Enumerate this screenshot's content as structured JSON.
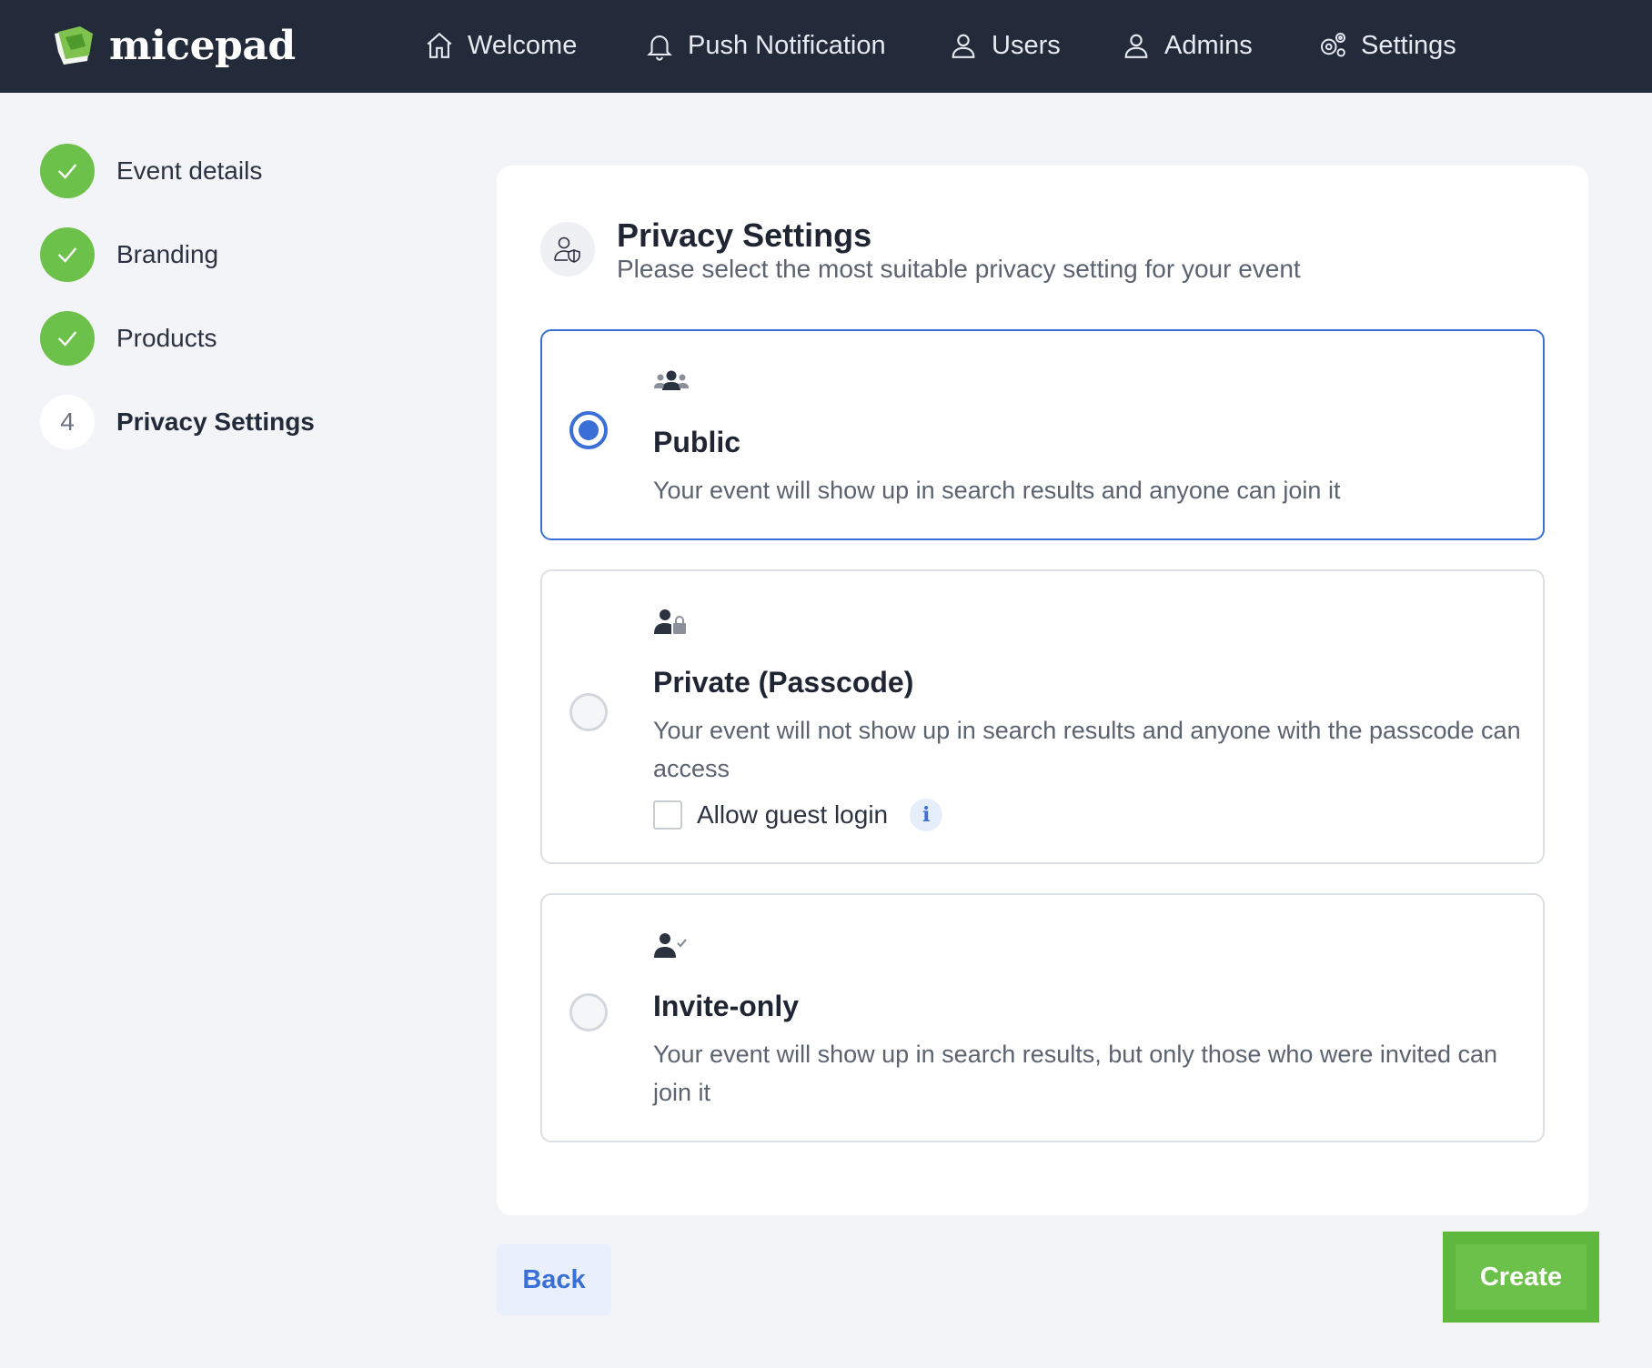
{
  "app": {
    "brand": "micepad"
  },
  "nav": {
    "items": [
      {
        "label": "Welcome",
        "icon": "home-icon"
      },
      {
        "label": "Push Notification",
        "icon": "bell-icon"
      },
      {
        "label": "Users",
        "icon": "user-icon"
      },
      {
        "label": "Admins",
        "icon": "user-icon"
      },
      {
        "label": "Settings",
        "icon": "gears-icon"
      }
    ]
  },
  "steps": [
    {
      "label": "Event details",
      "status": "complete"
    },
    {
      "label": "Branding",
      "status": "complete"
    },
    {
      "label": "Products",
      "status": "complete"
    },
    {
      "number": "4",
      "label": "Privacy Settings",
      "status": "current"
    }
  ],
  "privacy": {
    "title": "Privacy Settings",
    "subtitle": "Please select the most suitable privacy setting for your event",
    "options": [
      {
        "title": "Public",
        "description": "Your event will show up in search results and anyone can join it",
        "icon": "group-icon",
        "selected": true
      },
      {
        "title": "Private (Passcode)",
        "description": "Your event will not show up in search results and anyone with the passcode can access",
        "icon": "user-lock-icon",
        "selected": false,
        "guest_login": {
          "label": "Allow guest login",
          "checked": false
        }
      },
      {
        "title": "Invite-only",
        "description": "Your event will show up in search results, but only those who were invited can join it",
        "icon": "user-check-icon",
        "selected": false
      }
    ]
  },
  "actions": {
    "back": "Back",
    "create": "Create"
  },
  "colors": {
    "topbar": "#232b3a",
    "accent_blue": "#3a6fd8",
    "success_green": "#6cc14a",
    "background": "#f2f4f8"
  }
}
